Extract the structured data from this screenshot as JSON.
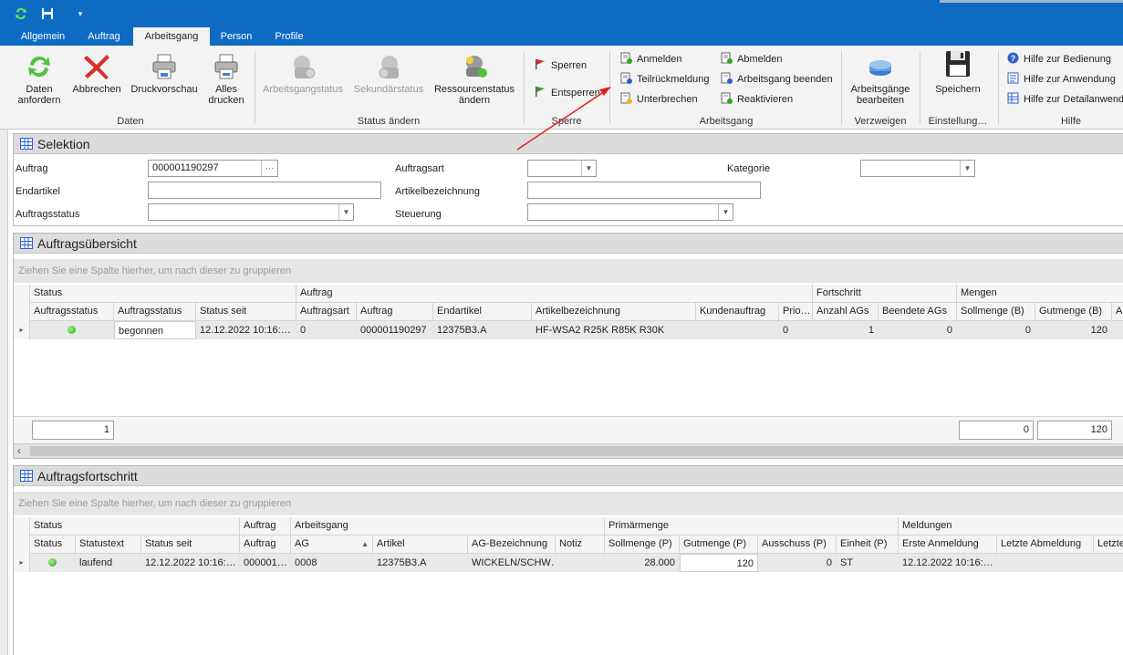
{
  "qat": {
    "refresh_icon": "refresh-icon",
    "save_icon": "floppy-icon",
    "customize_icon": "chevron-down-icon"
  },
  "tabs": [
    "Allgemein",
    "Auftrag",
    "Arbeitsgang",
    "Person",
    "Profile"
  ],
  "ribbon": {
    "daten": {
      "daten_anfordern": "Daten\nanfordern",
      "abbrechen": "Abbrechen",
      "druckvorschau": "Druckvorschau",
      "alles_drucken": "Alles\ndrucken",
      "group": "Daten"
    },
    "status": {
      "arbeitsgangstatus": "Arbeitsgangstatus",
      "sekundaerstatus": "Sekundärstatus",
      "ressourcenstatus": "Ressourcenstatus\nändern",
      "group": "Status ändern"
    },
    "sperre": {
      "sperren": "Sperren",
      "entsperren": "Entsperren",
      "group": "Sperre"
    },
    "arbeitsgang": {
      "anmelden": "Anmelden",
      "teilrueckmeldung": "Teilrückmeldung",
      "unterbrechen": "Unterbrechen",
      "abmelden": "Abmelden",
      "arbeitsgang_beenden": "Arbeitsgang beenden",
      "reaktivieren": "Reaktivieren",
      "group": "Arbeitsgang"
    },
    "verzweigen": {
      "arbeitsgaenge_bearbeiten": "Arbeitsgänge\nbearbeiten",
      "group": "Verzweigen"
    },
    "einstellungen": {
      "speichern": "Speichern",
      "group": "Einstellung…"
    },
    "hilfe": {
      "bedienung": "Hilfe zur Bedienung",
      "anwendung": "Hilfe zur Anwendung",
      "detail": "Hilfe zur Detailanwend",
      "group": "Hilfe"
    }
  },
  "selektion": {
    "title": "Selektion",
    "auftrag_label": "Auftrag",
    "auftrag_value": "000001190297",
    "auftrag_btn": "···",
    "endartikel_label": "Endartikel",
    "auftragsstatus_label": "Auftragsstatus",
    "auftragsart_label": "Auftragsart",
    "artikelbezeichnung_label": "Artikelbezeichnung",
    "steuerung_label": "Steuerung",
    "kategorie_label": "Kategorie",
    "dropdown_arrow": "▼"
  },
  "uebersicht": {
    "title": "Auftragsübersicht",
    "group_hint": "Ziehen Sie eine Spalte hierher, um nach dieser zu gruppieren",
    "bands": [
      "Status",
      "Auftrag",
      "Fortschritt",
      "Mengen"
    ],
    "columns": [
      "Auftragsstatus",
      "Auftragsstatus",
      "Status seit",
      "Auftragsart",
      "Auftrag",
      "Endartikel",
      "Artikelbezeichnung",
      "Kundenauftrag",
      "Prio…",
      "Anzahl AGs",
      "Beendete AGs",
      "Sollmenge (B)",
      "Gutmenge (B)",
      "A"
    ],
    "row": [
      "",
      "begonnen",
      "12.12.2022 10:16:…",
      "0",
      "000001190297",
      "12375B3.A",
      "HF-WSA2 R25K  R85K  R30K",
      "",
      "0",
      "1",
      "0",
      "0",
      "120",
      ""
    ],
    "summary": [
      "1",
      "0",
      "120"
    ],
    "scroll_left": "‹"
  },
  "fortschritt": {
    "title": "Auftragsfortschritt",
    "group_hint": "Ziehen Sie eine Spalte hierher, um nach dieser zu gruppieren",
    "bands": [
      "Status",
      "Auftrag",
      "Arbeitsgang",
      "Primärmenge",
      "Meldungen"
    ],
    "columns": [
      "Status",
      "Statustext",
      "Status seit",
      "Auftrag",
      "AG",
      "Artikel",
      "AG-Bezeichnung",
      "Notiz",
      "Sollmenge (P)",
      "Gutmenge (P)",
      "Ausschuss (P)",
      "Einheit (P)",
      "Erste Anmeldung",
      "Letzte Abmeldung",
      "Letzte"
    ],
    "sort_icon": "▲",
    "row": [
      "",
      "laufend",
      "12.12.2022 10:16:…",
      "000001…",
      "0008",
      "12375B3.A",
      "WICKELN/SCHW…",
      "",
      "28.000",
      "120",
      "0",
      "ST",
      "12.12.2022 10:16:…",
      "",
      ""
    ]
  },
  "colors": {
    "accent": "#0d6bc4",
    "arrow": "#e02020"
  }
}
